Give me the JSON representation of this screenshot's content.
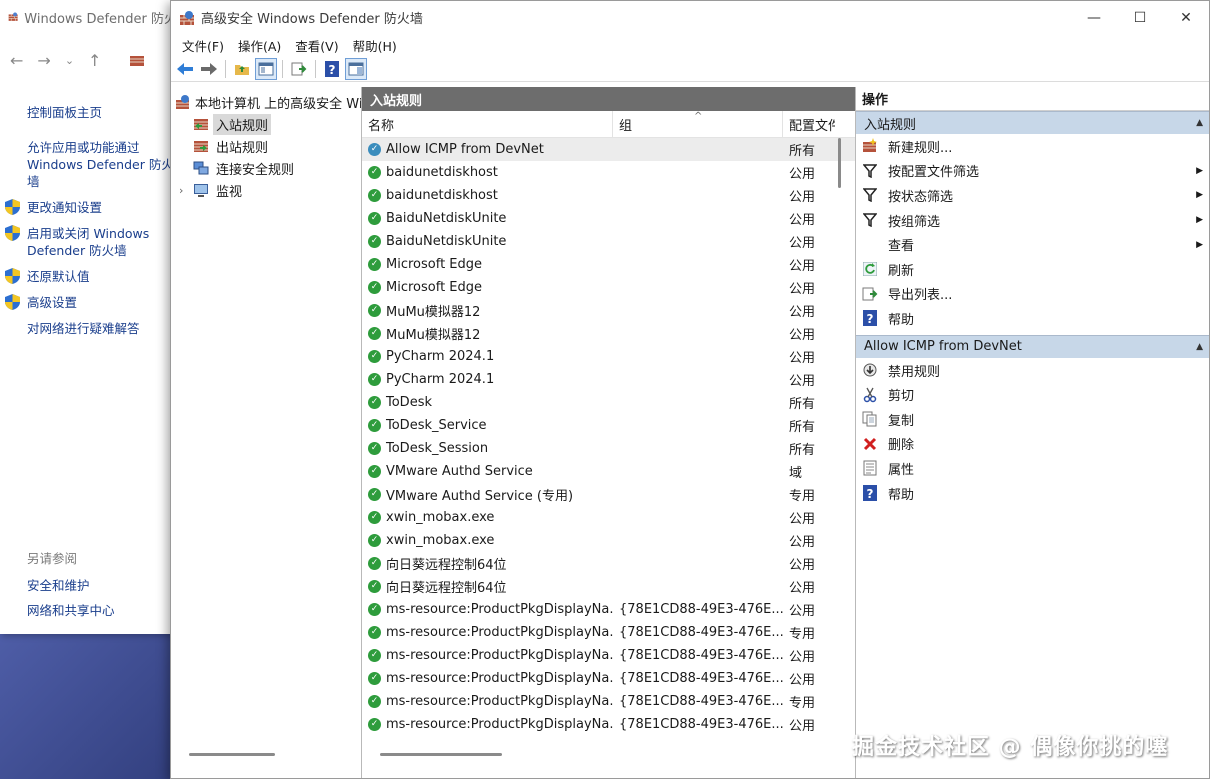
{
  "bg_window": {
    "title": "Windows Defender 防火",
    "links_top": [
      {
        "label": "控制面板主页",
        "shield": false
      },
      {
        "label": "允许应用或功能通过 Windows Defender 防火墙",
        "shield": false
      },
      {
        "label": "更改通知设置",
        "shield": true
      },
      {
        "label": "启用或关闭 Windows Defender 防火墙",
        "shield": true
      },
      {
        "label": "还原默认值",
        "shield": true
      },
      {
        "label": "高级设置",
        "shield": true
      },
      {
        "label": "对网络进行疑难解答",
        "shield": false
      }
    ],
    "see_also_label": "另请参阅",
    "see_also": [
      "安全和维护",
      "网络和共享中心"
    ]
  },
  "window": {
    "title": "高级安全 Windows Defender 防火墙",
    "menu": [
      "文件(F)",
      "操作(A)",
      "查看(V)",
      "帮助(H)"
    ]
  },
  "tree": {
    "root": "本地计算机 上的高级安全 Windows Defender 防火墙",
    "children": [
      {
        "label": "入站规则",
        "selected": true
      },
      {
        "label": "出站规则",
        "selected": false
      },
      {
        "label": "连接安全规则",
        "selected": false
      },
      {
        "label": "监视",
        "selected": false,
        "expandable": true
      }
    ]
  },
  "list": {
    "header": "入站规则",
    "columns": [
      "名称",
      "组",
      "配置文件"
    ],
    "rows": [
      {
        "name": "Allow ICMP from DevNet",
        "group": "",
        "profile": "所有",
        "selected": true
      },
      {
        "name": "baidunetdiskhost",
        "group": "",
        "profile": "公用"
      },
      {
        "name": "baidunetdiskhost",
        "group": "",
        "profile": "公用"
      },
      {
        "name": "BaiduNetdiskUnite",
        "group": "",
        "profile": "公用"
      },
      {
        "name": "BaiduNetdiskUnite",
        "group": "",
        "profile": "公用"
      },
      {
        "name": "Microsoft Edge",
        "group": "",
        "profile": "公用"
      },
      {
        "name": "Microsoft Edge",
        "group": "",
        "profile": "公用"
      },
      {
        "name": "MuMu模拟器12",
        "group": "",
        "profile": "公用"
      },
      {
        "name": "MuMu模拟器12",
        "group": "",
        "profile": "公用"
      },
      {
        "name": "PyCharm 2024.1",
        "group": "",
        "profile": "公用"
      },
      {
        "name": "PyCharm 2024.1",
        "group": "",
        "profile": "公用"
      },
      {
        "name": "ToDesk",
        "group": "",
        "profile": "所有"
      },
      {
        "name": "ToDesk_Service",
        "group": "",
        "profile": "所有"
      },
      {
        "name": "ToDesk_Session",
        "group": "",
        "profile": "所有"
      },
      {
        "name": "VMware Authd Service",
        "group": "",
        "profile": "域"
      },
      {
        "name": "VMware Authd Service (专用)",
        "group": "",
        "profile": "专用"
      },
      {
        "name": "xwin_mobax.exe",
        "group": "",
        "profile": "公用"
      },
      {
        "name": "xwin_mobax.exe",
        "group": "",
        "profile": "公用"
      },
      {
        "name": "向日葵远程控制64位",
        "group": "",
        "profile": "公用"
      },
      {
        "name": "向日葵远程控制64位",
        "group": "",
        "profile": "公用"
      },
      {
        "name": "ms-resource:ProductPkgDisplayNa...",
        "group": "{78E1CD88-49E3-476E...",
        "profile": "公用"
      },
      {
        "name": "ms-resource:ProductPkgDisplayNa...",
        "group": "{78E1CD88-49E3-476E...",
        "profile": "专用"
      },
      {
        "name": "ms-resource:ProductPkgDisplayNa...",
        "group": "{78E1CD88-49E3-476E...",
        "profile": "公用"
      },
      {
        "name": "ms-resource:ProductPkgDisplayNa...",
        "group": "{78E1CD88-49E3-476E...",
        "profile": "公用"
      },
      {
        "name": "ms-resource:ProductPkgDisplayNa...",
        "group": "{78E1CD88-49E3-476E...",
        "profile": "专用"
      },
      {
        "name": "ms-resource:ProductPkgDisplayNa...",
        "group": "{78E1CD88-49E3-476E...",
        "profile": "公用"
      }
    ]
  },
  "actions": {
    "title": "操作",
    "section1": {
      "label": "入站规则",
      "items": [
        {
          "label": "新建规则...",
          "icon": "new-rule-icon",
          "submenu": false
        },
        {
          "label": "按配置文件筛选",
          "icon": "filter-icon",
          "submenu": true
        },
        {
          "label": "按状态筛选",
          "icon": "filter-icon",
          "submenu": true
        },
        {
          "label": "按组筛选",
          "icon": "filter-icon",
          "submenu": true
        },
        {
          "label": "查看",
          "icon": "",
          "submenu": true
        },
        {
          "label": "刷新",
          "icon": "refresh-icon",
          "submenu": false
        },
        {
          "label": "导出列表...",
          "icon": "export-icon",
          "submenu": false
        },
        {
          "label": "帮助",
          "icon": "help-icon",
          "submenu": false
        }
      ]
    },
    "section2": {
      "label": "Allow ICMP from DevNet",
      "items": [
        {
          "label": "禁用规则",
          "icon": "disable-icon"
        },
        {
          "label": "剪切",
          "icon": "cut-icon"
        },
        {
          "label": "复制",
          "icon": "copy-icon"
        },
        {
          "label": "删除",
          "icon": "delete-icon"
        },
        {
          "label": "属性",
          "icon": "properties-icon"
        },
        {
          "label": "帮助",
          "icon": "help-icon"
        }
      ]
    }
  },
  "watermark": "掘金技术社区 @ 偶像你挑的噻",
  "colors": {
    "accent_section": "#c7d7e8",
    "pane_header": "#6d6d6d",
    "check": "#2e9c3c"
  }
}
